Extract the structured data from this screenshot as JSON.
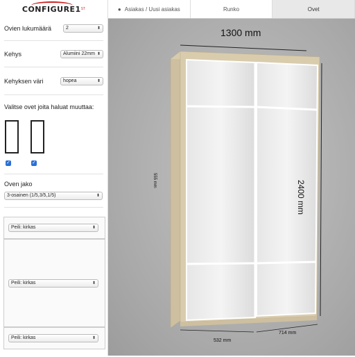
{
  "logo": {
    "text": "CONFIGURE1",
    "superscript": "ST"
  },
  "tabs": [
    {
      "label": "Asiakas / Uusi asiakas",
      "icon": "user-icon",
      "active": false
    },
    {
      "label": "Runko",
      "active": false
    },
    {
      "label": "Ovet",
      "active": true
    }
  ],
  "sidebar": {
    "door_count": {
      "label": "Ovien lukumäärä",
      "value": "2"
    },
    "frame": {
      "label": "Kehys",
      "value": "Alumiini 22mm"
    },
    "frame_color": {
      "label": "Kehyksen väri",
      "value": "hopea"
    },
    "select_doors_label": "Valitse ovet joita haluat muuttaa:",
    "door_checks": [
      true,
      true
    ],
    "door_split": {
      "label": "Oven jako",
      "value": "3-osainen (1/5,3/5,1/5)"
    },
    "panels": [
      {
        "value": "Peili: kirkas"
      },
      {
        "value": "Peili: kirkas"
      },
      {
        "value": "Peili: kirkas"
      }
    ]
  },
  "preview": {
    "width_label": "1300 mm",
    "height_label": "2400 mm",
    "depth_label": "555 mm",
    "door_widths": [
      "532 mm",
      "714 mm"
    ]
  },
  "colors": {
    "accent": "#c22222",
    "checkbox": "#2a6fd6",
    "frame": "#d8c9a8",
    "stage_bg": "#b0b0b0"
  }
}
